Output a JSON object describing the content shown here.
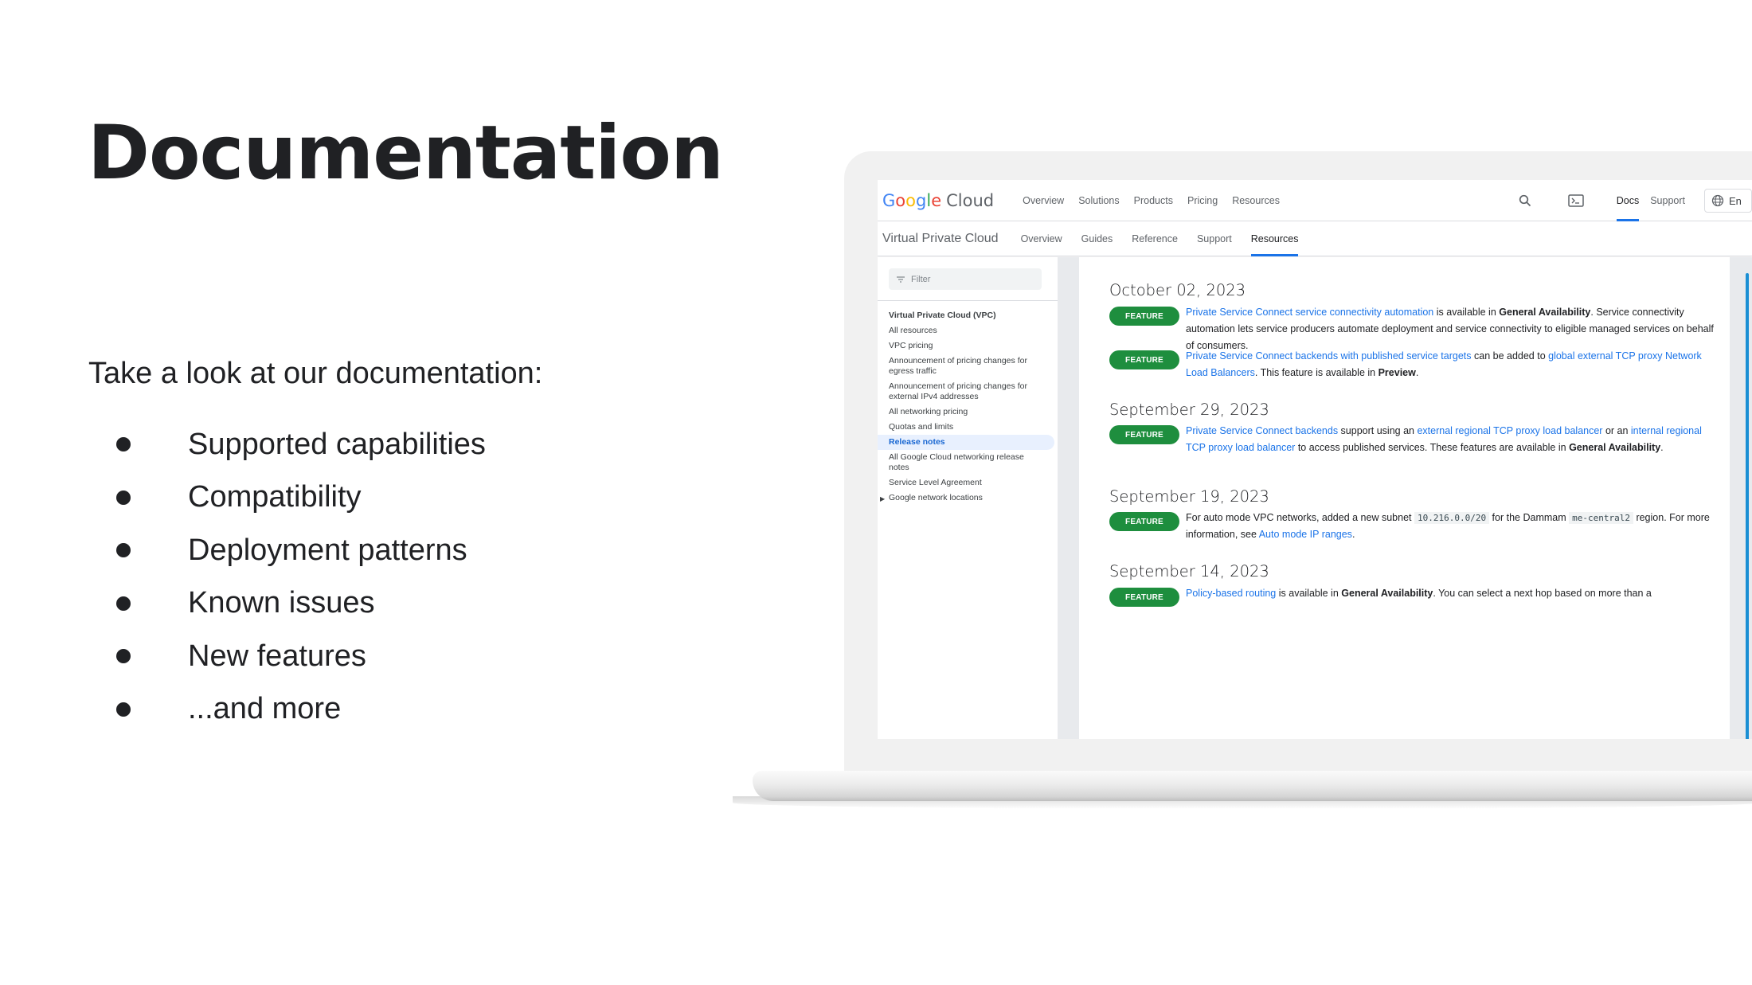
{
  "slide": {
    "title": "Documentation",
    "intro": "Take a look at our documentation:",
    "bullets": [
      "Supported capabilities",
      "Compatibility",
      "Deployment patterns",
      "Known issues",
      "New features",
      "...and more"
    ]
  },
  "browser": {
    "logo": {
      "google_letters": [
        "G",
        "o",
        "o",
        "g",
        "l",
        "e"
      ],
      "google_colors": [
        "#4285f4",
        "#ea4335",
        "#fbbc05",
        "#4285f4",
        "#34a853",
        "#ea4335"
      ],
      "cloud": "Cloud"
    },
    "top_nav": [
      "Overview",
      "Solutions",
      "Products",
      "Pricing",
      "Resources"
    ],
    "top_right": {
      "search_icon": "search-icon",
      "terminal_icon": "terminal-icon",
      "docs": "Docs",
      "support": "Support",
      "language_icon": "globe-icon",
      "language": "En"
    },
    "product_name": "Virtual Private Cloud",
    "sub_nav": [
      "Overview",
      "Guides",
      "Reference",
      "Support",
      "Resources"
    ],
    "sub_nav_active": "Resources",
    "accent_color": "#1a73e8",
    "sidebar": {
      "filter_placeholder": "Filter",
      "items": [
        {
          "label": "Virtual Private Cloud (VPC)",
          "type": "head"
        },
        {
          "label": "All resources"
        },
        {
          "label": "VPC pricing"
        },
        {
          "label": "Announcement of pricing changes for egress traffic"
        },
        {
          "label": "Announcement of pricing changes for external IPv4 addresses"
        },
        {
          "label": "All networking pricing"
        },
        {
          "label": "Quotas and limits"
        },
        {
          "label": "Release notes",
          "type": "active"
        },
        {
          "label": "All Google Cloud networking release notes"
        },
        {
          "label": "Service Level Agreement"
        },
        {
          "label": "Google network locations",
          "type": "expandable"
        }
      ],
      "collapse_label": "‹"
    },
    "release_notes": [
      {
        "date": "October 02, 2023",
        "notes": [
          {
            "badge": "FEATURE",
            "parts": [
              {
                "t": "a",
                "v": "Private Service Connect service connectivity automation"
              },
              {
                "t": "s",
                "v": " is available in "
              },
              {
                "t": "b",
                "v": "General Availability"
              },
              {
                "t": "s",
                "v": ". Service connectivity automation lets service producers automate deployment and service connectivity to eligible managed services on behalf of consumers."
              }
            ]
          },
          {
            "badge": "FEATURE",
            "parts": [
              {
                "t": "a",
                "v": "Private Service Connect backends with published service targets"
              },
              {
                "t": "s",
                "v": " can be added to "
              },
              {
                "t": "a",
                "v": "global external TCP proxy Network Load Balancers"
              },
              {
                "t": "s",
                "v": ". This feature is available in "
              },
              {
                "t": "b",
                "v": "Preview"
              },
              {
                "t": "s",
                "v": "."
              }
            ]
          }
        ]
      },
      {
        "date": "September 29, 2023",
        "notes": [
          {
            "badge": "FEATURE",
            "parts": [
              {
                "t": "a",
                "v": "Private Service Connect backends"
              },
              {
                "t": "s",
                "v": " support using an "
              },
              {
                "t": "a",
                "v": "external regional TCP proxy load balancer"
              },
              {
                "t": "s",
                "v": " or an "
              },
              {
                "t": "a",
                "v": "internal regional TCP proxy load balancer"
              },
              {
                "t": "s",
                "v": " to access published services. These features are available in "
              },
              {
                "t": "b",
                "v": "General Availability"
              },
              {
                "t": "s",
                "v": "."
              }
            ]
          }
        ]
      },
      {
        "date": "September 19, 2023",
        "notes": [
          {
            "badge": "FEATURE",
            "parts": [
              {
                "t": "s",
                "v": "For auto mode VPC networks, added a new subnet "
              },
              {
                "t": "c",
                "v": "10.216.0.0/20"
              },
              {
                "t": "s",
                "v": " for the Dammam "
              },
              {
                "t": "c",
                "v": "me-central2"
              },
              {
                "t": "s",
                "v": " region. For more information, see "
              },
              {
                "t": "a",
                "v": "Auto mode IP ranges"
              },
              {
                "t": "s",
                "v": "."
              }
            ]
          }
        ]
      },
      {
        "date": "September 14, 2023",
        "notes": [
          {
            "badge": "FEATURE",
            "parts": [
              {
                "t": "a",
                "v": "Policy-based routing"
              },
              {
                "t": "s",
                "v": " is available in "
              },
              {
                "t": "b",
                "v": "General Availability"
              },
              {
                "t": "s",
                "v": ". You can select a next hop based on more than a"
              }
            ]
          }
        ]
      }
    ],
    "badge_color": "#1e8e3e"
  }
}
